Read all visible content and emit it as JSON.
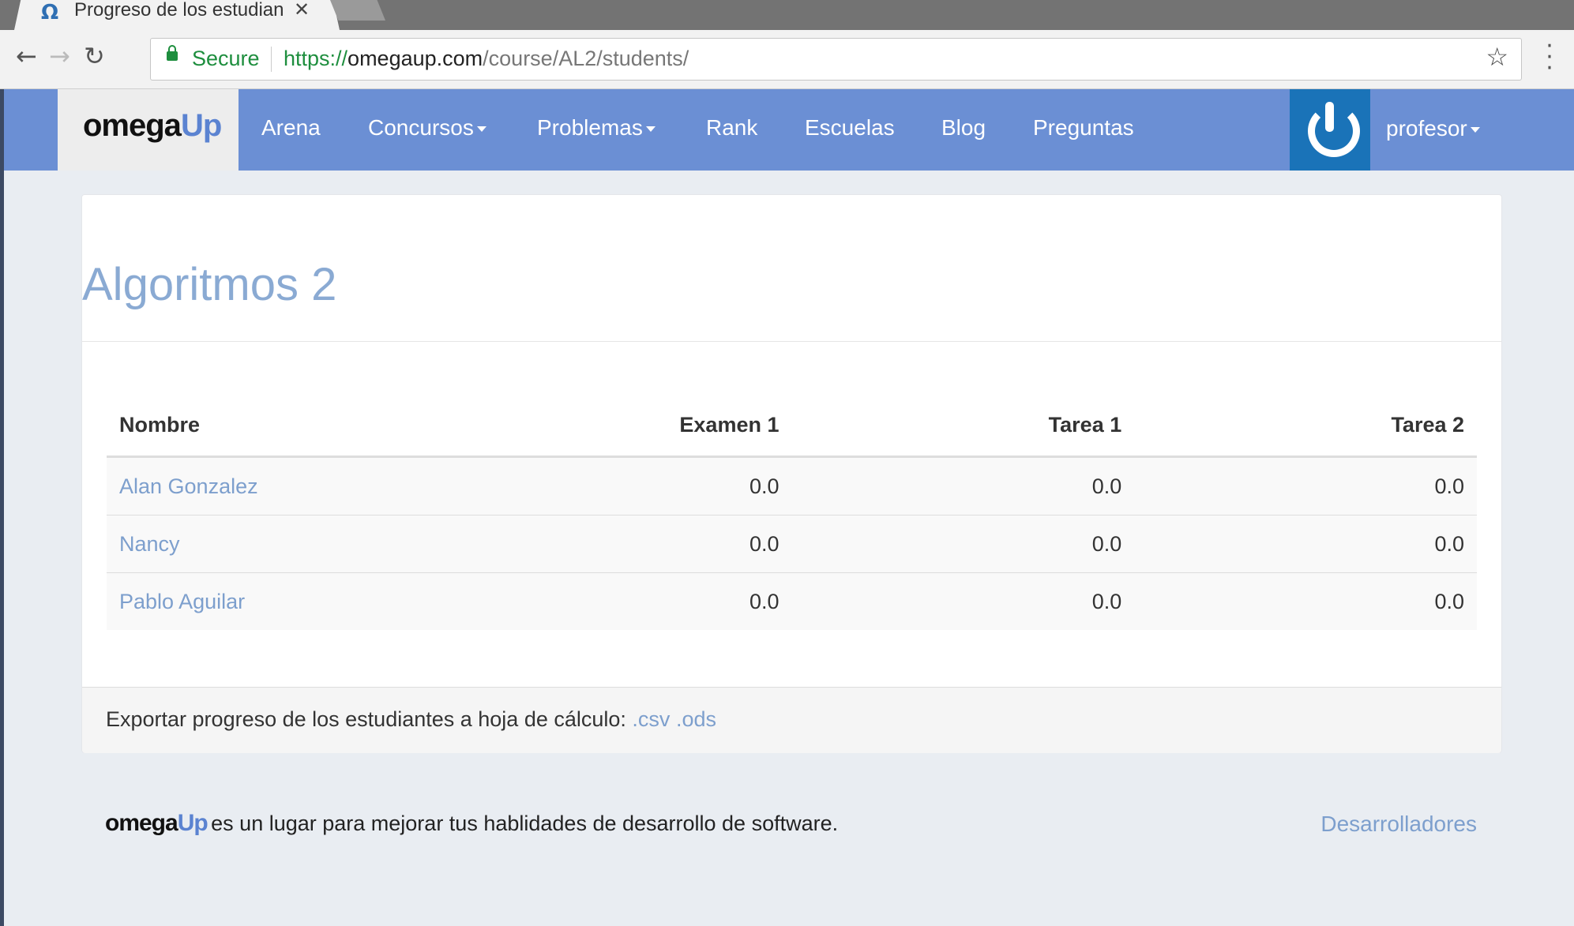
{
  "browser": {
    "tab_title": "Progreso de los estudiant",
    "secure_label": "Secure",
    "url_proto": "https://",
    "url_host": "omegaup.com",
    "url_path": "/course/AL2/students/"
  },
  "nav": {
    "brand_main": "omega",
    "brand_accent": "Up",
    "items": [
      "Arena",
      "Concursos",
      "Problemas",
      "Rank",
      "Escuelas",
      "Blog",
      "Preguntas"
    ],
    "user": "profesor"
  },
  "course": {
    "title": "Algoritmos 2",
    "columns": [
      "Nombre",
      "Examen 1",
      "Tarea 1",
      "Tarea 2"
    ],
    "students": [
      {
        "name": "Alan Gonzalez",
        "scores": [
          "0.0",
          "0.0",
          "0.0"
        ]
      },
      {
        "name": "Nancy",
        "scores": [
          "0.0",
          "0.0",
          "0.0"
        ]
      },
      {
        "name": "Pablo Aguilar",
        "scores": [
          "0.0",
          "0.0",
          "0.0"
        ]
      }
    ],
    "export_text": "Exportar progreso de los estudiantes a hoja de cálculo:",
    "export_csv": ".csv",
    "export_ods": ".ods"
  },
  "footer": {
    "brand_main": "omega",
    "brand_accent": "Up",
    "tagline": "es un lugar para mejorar tus hablidades de desarrollo de software.",
    "developers_link": "Desarrolladores"
  },
  "colors": {
    "navbar": "#6b8fd4",
    "link": "#7d9fcd",
    "title": "#8aaad3"
  }
}
